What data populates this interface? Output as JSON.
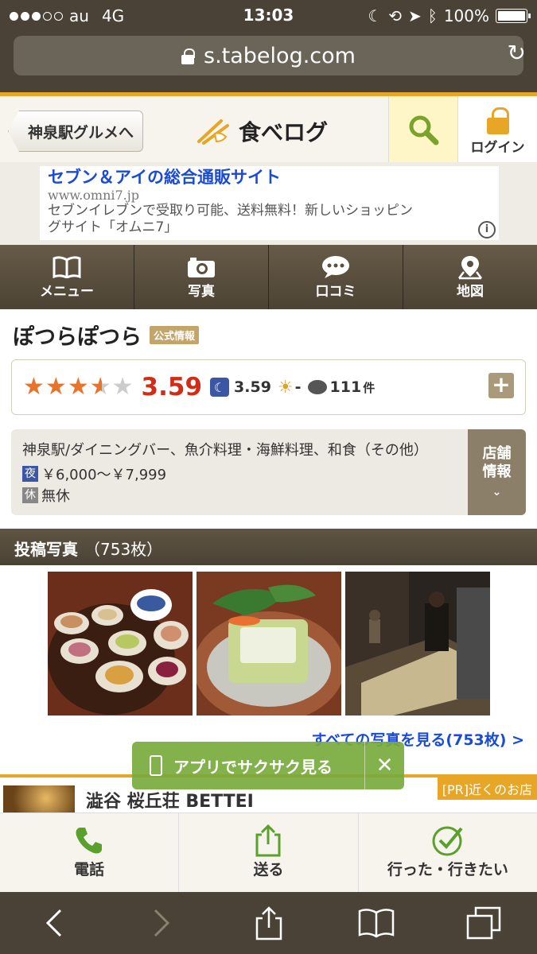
{
  "status": {
    "carrier": "au",
    "network": "4G",
    "time": "13:03",
    "battery": "100%",
    "signal_bars": 3,
    "signal_total": 5
  },
  "browser": {
    "url": "s.tabelog.com"
  },
  "header": {
    "back_label": "神泉駅グルメへ",
    "logo_text": "食べログ",
    "login_label": "ログイン"
  },
  "ad": {
    "title": "セブン＆アイの総合通販サイト",
    "url": "www.omni7.jp",
    "desc": "セブンイレブンで受取り可能、送料無料！新しいショッピングサイト「オムニ7」"
  },
  "nav": {
    "items": [
      {
        "label": "メニュー",
        "icon": "book-icon"
      },
      {
        "label": "写真",
        "icon": "camera-icon"
      },
      {
        "label": "口コミ",
        "icon": "chat-icon"
      },
      {
        "label": "地図",
        "icon": "map-pin-icon"
      }
    ]
  },
  "restaurant": {
    "name": "ぽつらぽつら",
    "official_badge": "公式情報",
    "rating": "3.59",
    "rating_value": 3.59,
    "night_rating": "3.59",
    "lunch_rating": "-",
    "review_count": "111",
    "review_unit": "件",
    "category": "神泉駅/ダイニングバー、魚介料理・海鮮料理、和食（その他）",
    "night_tag": "夜",
    "price": "￥6,000～￥7,999",
    "holiday_tag": "休",
    "holiday": "無休",
    "store_info_label": "店舗情報"
  },
  "photos": {
    "header": "投稿写真",
    "count": "（753枚）",
    "view_all": "すべての写真を見る(753枚) >"
  },
  "toast": {
    "text": "アプリでサクサク見る"
  },
  "pr": {
    "label": "[PR]近くのお店",
    "name": "澁谷 桜丘荘 BETTEI"
  },
  "actions": {
    "call": "電話",
    "send": "送る",
    "went": "行った・行きたい"
  },
  "colors": {
    "brand_orange": "#e8a626",
    "nav_brown": "#5a4f3e",
    "rating_red": "#d12c17",
    "link_blue": "#1a4bd6",
    "toast_green": "#78aa3c"
  }
}
